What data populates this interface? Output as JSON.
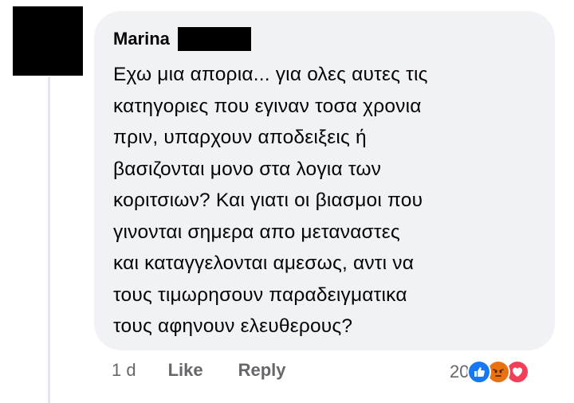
{
  "comment": {
    "author": "Marina",
    "text_lines": [
      "Εχω μια απορια... για ολες αυτες τις",
      "κατηγοριες που εγιναν τοσα χρονια",
      "πριν, υπαρχουν αποδειξεις ή",
      "βασιζονται μονο στα λογια των",
      "κοριτσιων? Και γιατι οι βιασμοι που",
      "γινονται σημερα απο μεταναστες",
      "και καταγγελονται αμεσως, αντι να",
      "τους τιμωρησουν παραδειγματικα",
      "τους αφηνουν ελευθερους?"
    ]
  },
  "footer": {
    "time": "1 d",
    "like_label": "Like",
    "reply_label": "Reply"
  },
  "reactions": {
    "count": "20",
    "icons": [
      "like-icon",
      "angry-icon",
      "love-icon"
    ]
  },
  "colors": {
    "bubble": "#f0f2f5",
    "meta_text": "#65676b",
    "like": "#1877f2",
    "angry": "#e9710f",
    "love": "#f33e58"
  }
}
